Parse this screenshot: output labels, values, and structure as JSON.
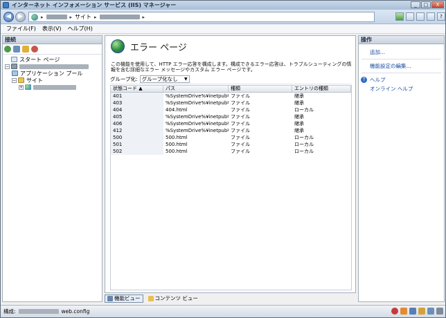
{
  "window": {
    "title": "インターネット インフォメーション サービス (IIS) マネージャー"
  },
  "window_buttons": {
    "minimize": "_",
    "maximize": "□",
    "close": "X"
  },
  "address": {
    "crumbs": [
      "サイト"
    ],
    "separators": [
      "▸",
      "▸",
      "▸",
      "▸"
    ]
  },
  "menu": {
    "file": "ファイル(F)",
    "view": "表示(V)",
    "help": "ヘルプ(H)"
  },
  "connections": {
    "header": "接続",
    "tree": {
      "start_page": "スタート ページ",
      "app_pools": "アプリケーション プール",
      "sites": "サイト"
    }
  },
  "main": {
    "title": "エラー ページ",
    "description": "この機能を使用して、HTTP エラー応答を構成します。構成できるエラー応答は、トラブルシューティングの情報を含む詳細なエラー メッセージやカスタム エラー ページです。",
    "group_label": "グループ化:",
    "group_value": "グループ化なし",
    "columns": [
      "状態コード",
      "パス",
      "種類",
      "エントリの種類"
    ],
    "sort_indicator": "▲",
    "rows": [
      {
        "code": "401",
        "path": "%SystemDrive%¥inetpub¥c...",
        "type": "ファイル",
        "entry": "継承"
      },
      {
        "code": "403",
        "path": "%SystemDrive%¥inetpub¥c...",
        "type": "ファイル",
        "entry": "継承"
      },
      {
        "code": "404",
        "path": "404.html",
        "type": "ファイル",
        "entry": "ローカル"
      },
      {
        "code": "405",
        "path": "%SystemDrive%¥inetpub¥c...",
        "type": "ファイル",
        "entry": "継承"
      },
      {
        "code": "406",
        "path": "%SystemDrive%¥inetpub¥c...",
        "type": "ファイル",
        "entry": "継承"
      },
      {
        "code": "412",
        "path": "%SystemDrive%¥inetpub¥c...",
        "type": "ファイル",
        "entry": "継承"
      },
      {
        "code": "500",
        "path": "500.html",
        "type": "ファイル",
        "entry": "ローカル"
      },
      {
        "code": "501",
        "path": "500.html",
        "type": "ファイル",
        "entry": "ローカル"
      },
      {
        "code": "502",
        "path": "500.html",
        "type": "ファイル",
        "entry": "ローカル"
      }
    ]
  },
  "view_tabs": {
    "features": "機能ビュー",
    "content": "コンテンツ ビュー"
  },
  "actions": {
    "header": "操作",
    "add": "追加...",
    "edit_settings": "機能設定の編集...",
    "help": "ヘルプ",
    "online_help": "オンライン ヘルプ"
  },
  "status": {
    "label": "構成:",
    "file": "web.config"
  }
}
